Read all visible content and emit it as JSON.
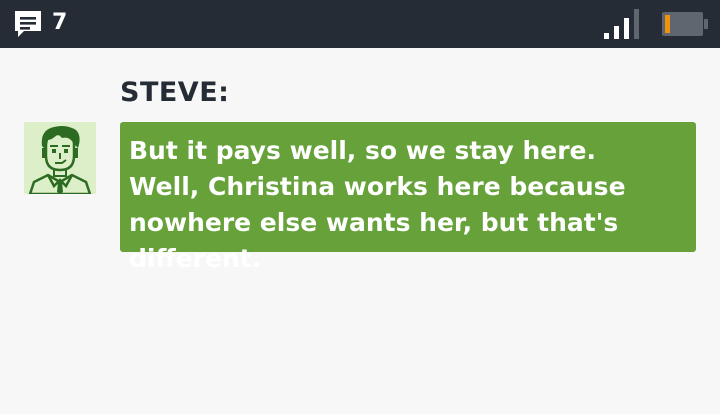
{
  "status_bar": {
    "message_icon": "chat-bubble-icon",
    "message_count": "7",
    "signal_icon": "signal-strength-icon",
    "battery_icon": "battery-low-icon",
    "battery_level": 0.15,
    "battery_color": "#f0920c",
    "background_color": "#262c35"
  },
  "dialogue": {
    "speaker": "STEVE:",
    "avatar_icon": "steve-portrait-icon",
    "message": "But it pays well, so we stay here. Well, Christina works here because nowhere else wants her, but that's different.",
    "bubble_color": "#66a13a"
  }
}
